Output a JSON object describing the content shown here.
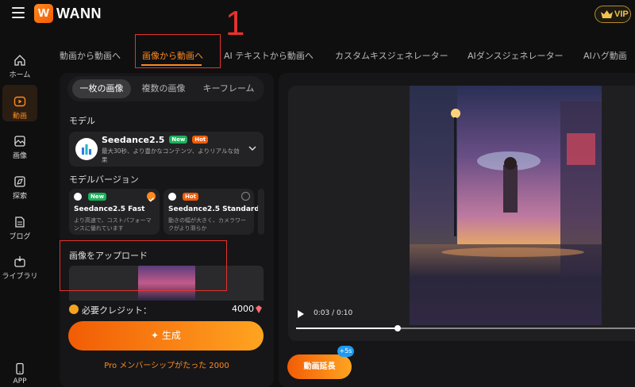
{
  "app": {
    "brand_letter": "W",
    "brand_name": "WANN",
    "vip_label": "VIP"
  },
  "colors": {
    "accent": "#ff8a1f",
    "annotation": "#e5322d",
    "badge_new": "#19b35a",
    "badge_hot": "#f25c05",
    "extend_badge": "#1e9bf0"
  },
  "sidebar": {
    "items": [
      {
        "label": "ホーム",
        "icon": "home-icon"
      },
      {
        "label": "動画",
        "icon": "video-icon",
        "active": true
      },
      {
        "label": "画像",
        "icon": "image-icon"
      },
      {
        "label": "探索",
        "icon": "explore-icon"
      },
      {
        "label": "ブログ",
        "icon": "blog-icon"
      },
      {
        "label": "ライブラリ",
        "icon": "library-icon"
      },
      {
        "label": "APP",
        "icon": "phone-icon"
      }
    ]
  },
  "tabs": [
    {
      "label": "動画から動画へ"
    },
    {
      "label": "画像から動画へ",
      "active": true
    },
    {
      "label": "AI テキストから動画へ"
    },
    {
      "label": "カスタムキスジェネレーター"
    },
    {
      "label": "AIダンスジェネレーター"
    },
    {
      "label": "AIハグ動画"
    }
  ],
  "annotation": {
    "step_number": "1"
  },
  "panel": {
    "segments": [
      {
        "label": "一枚の画像",
        "active": true
      },
      {
        "label": "複数の画像"
      },
      {
        "label": "キーフレーム"
      }
    ],
    "model_label": "モデル",
    "model": {
      "name": "Seedance2.5",
      "badges": [
        "New",
        "Hot"
      ],
      "description": "最大30秒、より豊かなコンテンツ、よりリアルな効果"
    },
    "version_label": "モデルバージョン",
    "versions": [
      {
        "badge": "New",
        "name": "Seedance2.5 Fast",
        "desc_line1": "より高速で、コストパフォーマ",
        "desc_line2": "ンスに優れています",
        "selected": true
      },
      {
        "badge": "Hot",
        "name": "Seedance2.5 Standard",
        "desc_line1": "動きの幅が大きく、カメラワー",
        "desc_line2": "クがより滑らか",
        "selected": false
      }
    ],
    "upload_label": "画像をアップロード",
    "credit_label": "必要クレジット：",
    "credit_value": "4000",
    "generate_label": "生成",
    "pro_text": "Pro メンバーシップがたった 2000"
  },
  "player": {
    "time": "0:03 / 0:10",
    "progress": 0.3,
    "extend_label": "動画延長",
    "extend_badge": "+5s"
  }
}
